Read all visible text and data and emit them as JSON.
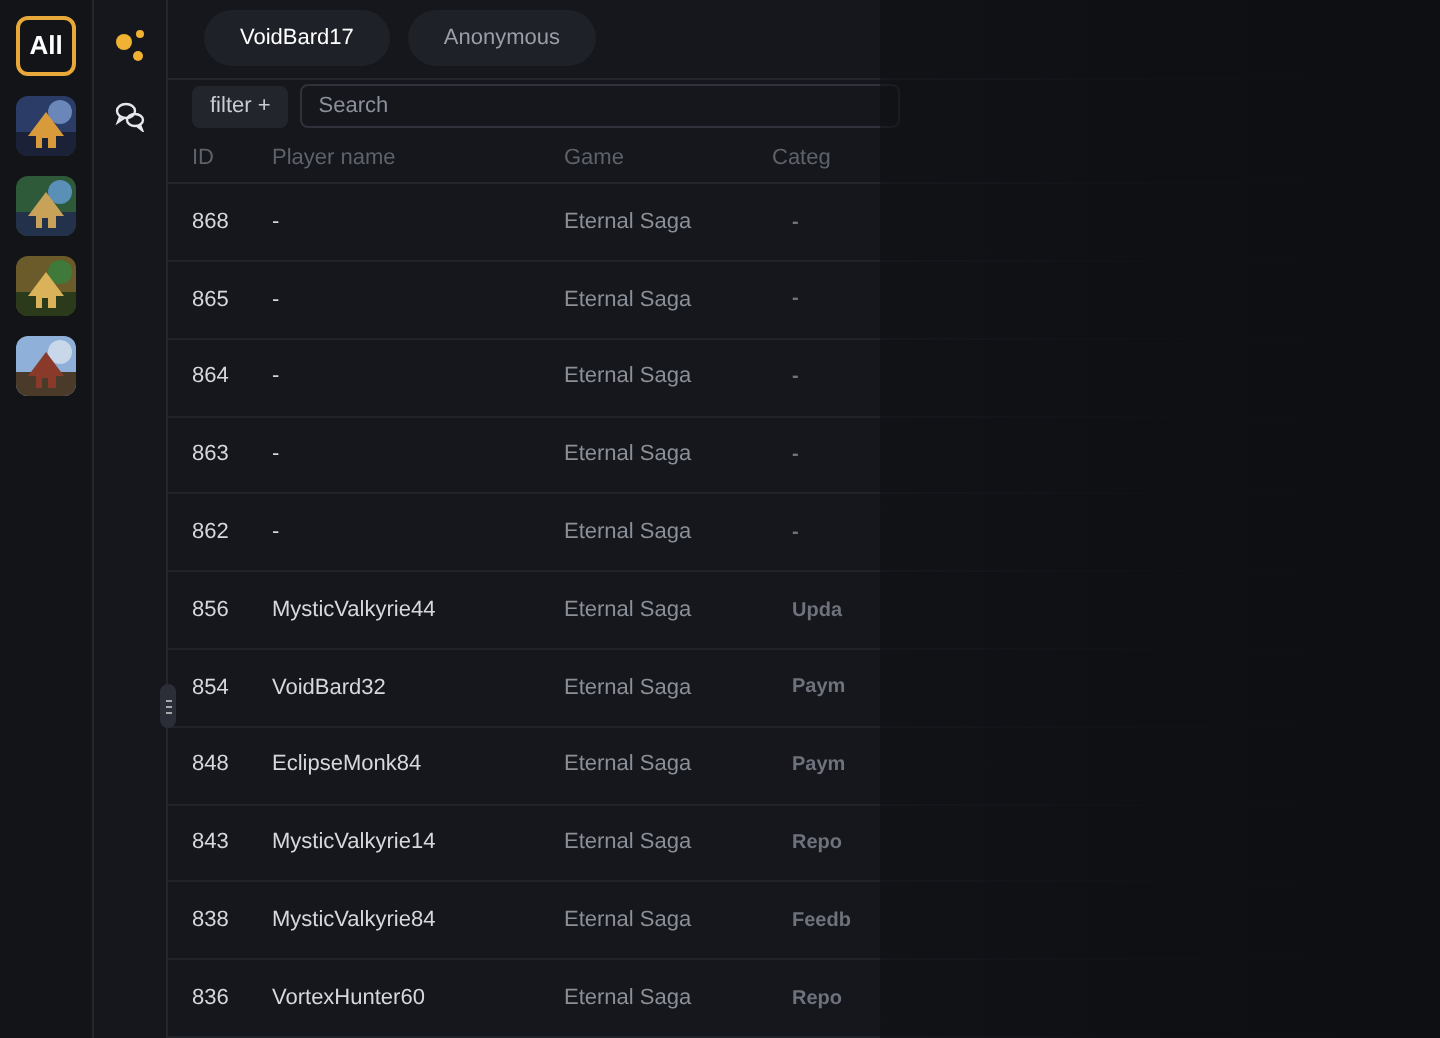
{
  "rail": {
    "all_label": "All",
    "all_selected": true
  },
  "tabs": [
    {
      "label": "VoidBard17",
      "selected": true
    },
    {
      "label": "Anonymous",
      "selected": false
    }
  ],
  "filter_button": "filter +",
  "search": {
    "placeholder": "Search"
  },
  "table": {
    "columns": [
      "ID",
      "Player name",
      "Game",
      "Categ"
    ],
    "rows": [
      {
        "id": "868",
        "player": "-",
        "game": "Eternal Saga",
        "category": "-"
      },
      {
        "id": "865",
        "player": "-",
        "game": "Eternal Saga",
        "category": "-"
      },
      {
        "id": "864",
        "player": "-",
        "game": "Eternal Saga",
        "category": "-"
      },
      {
        "id": "863",
        "player": "-",
        "game": "Eternal Saga",
        "category": "-"
      },
      {
        "id": "862",
        "player": "-",
        "game": "Eternal Saga",
        "category": "-"
      },
      {
        "id": "856",
        "player": "MysticValkyrie44",
        "game": "Eternal Saga",
        "category": "Upda"
      },
      {
        "id": "854",
        "player": "VoidBard32",
        "game": "Eternal Saga",
        "category": "Paym"
      },
      {
        "id": "848",
        "player": "EclipseMonk84",
        "game": "Eternal Saga",
        "category": "Paym"
      },
      {
        "id": "843",
        "player": "MysticValkyrie14",
        "game": "Eternal Saga",
        "category": "Repo"
      },
      {
        "id": "838",
        "player": "MysticValkyrie84",
        "game": "Eternal Saga",
        "category": "Feedb"
      },
      {
        "id": "836",
        "player": "VortexHunter60",
        "game": "Eternal Saga",
        "category": "Repo"
      }
    ]
  }
}
